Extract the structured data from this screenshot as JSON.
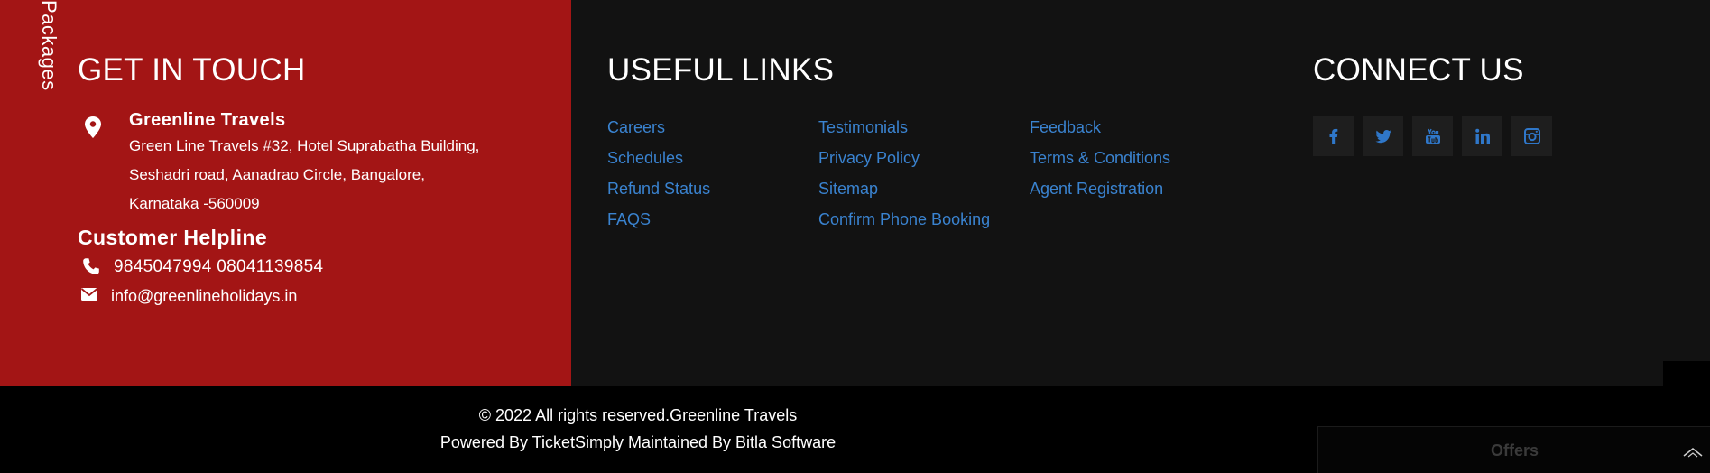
{
  "side_tab": {
    "label": "Packages"
  },
  "get_in_touch": {
    "title": "GET IN TOUCH",
    "company": "Greenline Travels",
    "address_lines": [
      "Green Line Travels #32, Hotel Suprabatha Building,",
      "Seshadri road, Aanadrao Circle, Bangalore,",
      "Karnataka -560009"
    ],
    "helpline_title": "Customer Helpline",
    "phones": "9845047994 08041139854",
    "email": "info@greenlineholidays.in"
  },
  "useful_links": {
    "title": "USEFUL LINKS",
    "columns": [
      [
        "Careers",
        "Schedules",
        "Refund Status",
        "FAQS"
      ],
      [
        "Testimonials",
        "Privacy Policy",
        "Sitemap",
        "Confirm Phone Booking"
      ],
      [
        "Feedback",
        "Terms & Conditions",
        "Agent Registration"
      ]
    ]
  },
  "connect": {
    "title": "CONNECT US",
    "icons": [
      "facebook-icon",
      "twitter-icon",
      "youtube-icon",
      "linkedin-icon",
      "instagram-icon"
    ]
  },
  "bottom": {
    "copyright": "© 2022 All rights reserved.Greenline Travels",
    "powered": "Powered By TicketSimply Maintained By Bitla Software"
  },
  "offers": {
    "label": "Offers"
  },
  "colors": {
    "panel_red": "#a31515",
    "dark_bg": "#121212",
    "link_blue": "#3a83d0"
  }
}
